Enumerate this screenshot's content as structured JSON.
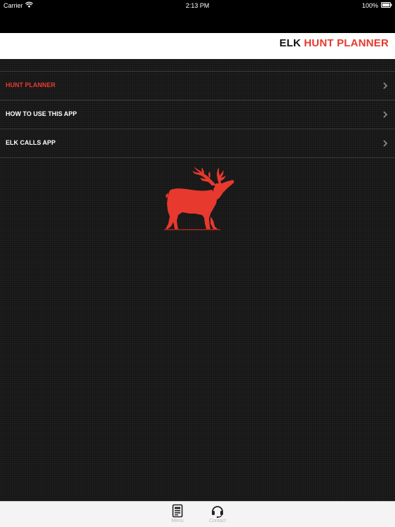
{
  "status_bar": {
    "carrier": "Carrier",
    "time": "2:13 PM",
    "battery": "100%"
  },
  "header": {
    "title_part1": "ELK",
    "title_part2": "HUNT PLANNER",
    "accent_color": "#e8392e"
  },
  "menu": {
    "items": [
      {
        "label": "HUNT PLANNER",
        "active": true
      },
      {
        "label": "HOW TO USE THIS APP",
        "active": false
      },
      {
        "label": "ELK CALLS APP",
        "active": false
      }
    ]
  },
  "logo": {
    "icon": "elk-silhouette-icon"
  },
  "tab_bar": {
    "tabs": [
      {
        "label": "Menu",
        "icon": "menu-card-icon"
      },
      {
        "label": "Contact",
        "icon": "headset-icon"
      }
    ]
  }
}
